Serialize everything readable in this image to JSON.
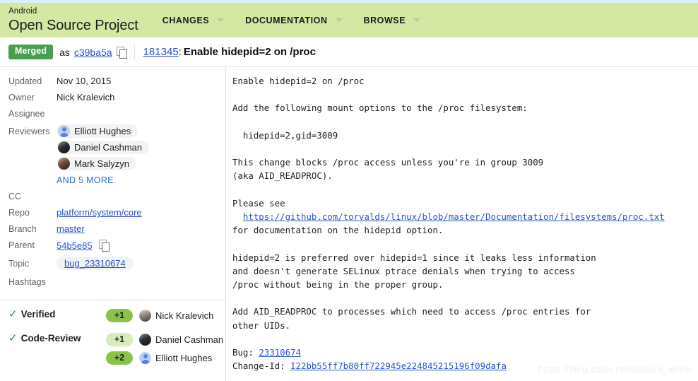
{
  "header": {
    "logo_top": "Android",
    "logo_bottom": "Open Source Project",
    "nav": [
      {
        "label": "CHANGES",
        "name": "nav-changes"
      },
      {
        "label": "DOCUMENTATION",
        "name": "nav-documentation"
      },
      {
        "label": "BROWSE",
        "name": "nav-browse"
      }
    ],
    "brand_bg": "#d4e8a4",
    "top_strip_color": "#d9f0fb"
  },
  "change_header": {
    "status_badge": "Merged",
    "as_label": "as",
    "commit_sha": "c39ba5a",
    "copy_icon": "copy-icon",
    "change_number": "181345",
    "colon": ":",
    "subject": "Enable hidepid=2 on /proc",
    "badge_color": "#4a9e53"
  },
  "metadata": {
    "rows": [
      {
        "label": "Updated",
        "value": "Nov 10, 2015"
      },
      {
        "label": "Owner",
        "value": "Nick Kralevich"
      },
      {
        "label": "Assignee",
        "value": ""
      },
      {
        "label": "Reviewers",
        "value": ""
      },
      {
        "label": "CC",
        "value": ""
      },
      {
        "label": "Repo",
        "value": "platform/system/core"
      },
      {
        "label": "Branch",
        "value": "master"
      },
      {
        "label": "Parent",
        "value": "54b5e85"
      },
      {
        "label": "Topic",
        "value": "bug_23310674"
      },
      {
        "label": "Hashtags",
        "value": ""
      }
    ],
    "reviewers": [
      {
        "name": "Elliott Hughes",
        "avatar": "default"
      },
      {
        "name": "Daniel Cashman",
        "avatar": "photo-dark"
      },
      {
        "name": "Mark Salyzyn",
        "avatar": "photo-brown"
      }
    ],
    "and_more": "AND 5 MORE"
  },
  "labels": [
    {
      "name": "Verified",
      "votes": [
        {
          "score": "+1",
          "voter": "Nick Kralevich",
          "avatar": "photo-nick",
          "strength": "strong"
        }
      ]
    },
    {
      "name": "Code-Review",
      "votes": [
        {
          "score": "+1",
          "voter": "Daniel Cashman",
          "avatar": "photo-dark",
          "strength": "weak"
        },
        {
          "score": "+2",
          "voter": "Elliott Hughes",
          "avatar": "default",
          "strength": "strong"
        }
      ]
    }
  ],
  "commit_message": {
    "before_link": "Enable hidepid=2 on /proc\n\nAdd the following mount options to the /proc filesystem:\n\n  hidepid=2,gid=3009\n\nThis change blocks /proc access unless you're in group 3009\n(aka AID_READPROC).\n\nPlease see\n  ",
    "doc_link": "https://github.com/torvalds/linux/blob/master/Documentation/filesystems/proc.txt",
    "after_link": "\nfor documentation on the hidepid option.\n\nhidepid=2 is preferred over hidepid=1 since it leaks less information\nand doesn't generate SELinux ptrace denials when trying to access\n/proc without being in the proper group.\n\nAdd AID_READPROC to processes which need to access /proc entries for\nother UIDs.\n\nBug: ",
    "bug_link": "23310674",
    "changeid_label": "\nChange-Id: ",
    "changeid_link": "I22bb55ff7b80ff722945e224845215196f09dafa"
  },
  "watermark": "https://blog.csdn.net/sakura_white"
}
